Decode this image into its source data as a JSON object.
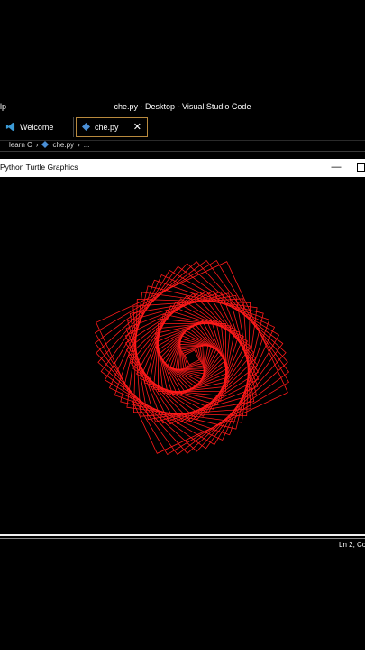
{
  "vscode": {
    "menu_partial": "lp",
    "window_title": "che.py - Desktop - Visual Studio Code",
    "tabs": [
      {
        "label": "Welcome"
      },
      {
        "label": "che.py"
      }
    ],
    "close_glyph": "✕",
    "breadcrumb": {
      "folder": "learn C",
      "file": "che.py",
      "ellipsis": "..."
    },
    "status": "Ln 2, Co"
  },
  "turtle_window": {
    "title": "Python Turtle Graphics",
    "minimize_glyph": "—"
  },
  "colors": {
    "background": "#000000",
    "spiral": "#ff1a1a",
    "vscode_accent": "#3c9bd6",
    "python_icon": "#4a8fd6",
    "active_tab_border": "#b98a3e"
  },
  "drawing": {
    "shape": "rotating square spiral",
    "iterations": 48
  }
}
